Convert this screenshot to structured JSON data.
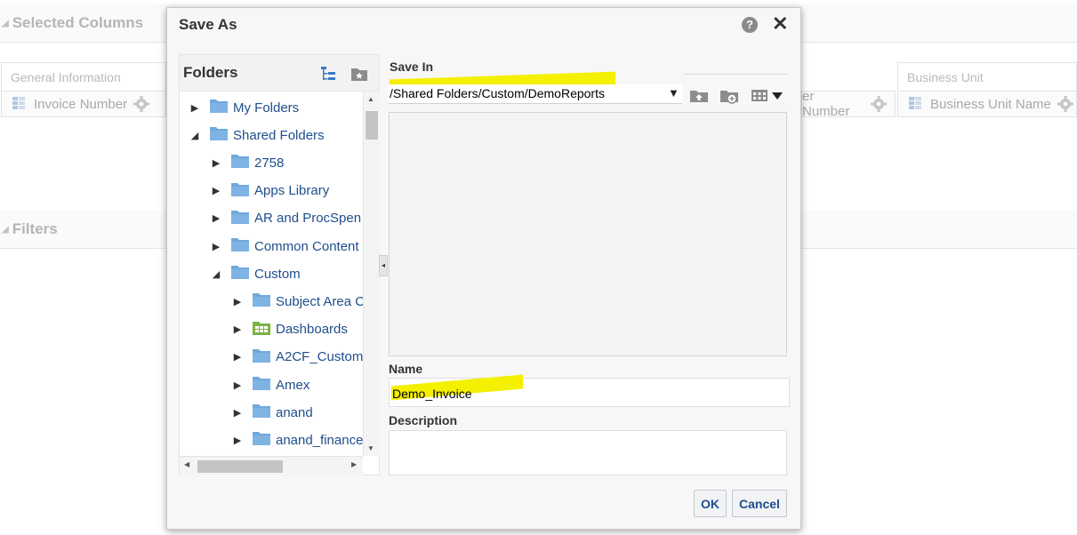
{
  "background": {
    "selected_columns_title": "Selected Columns",
    "filters_title": "Filters",
    "groups": [
      {
        "label": "General Information"
      },
      {
        "label": "Business Unit"
      }
    ],
    "columns": [
      {
        "label": "Invoice Number"
      },
      {
        "label": "er Number"
      },
      {
        "label": "Business Unit Name"
      }
    ]
  },
  "dialog": {
    "title": "Save As",
    "help_glyph": "?",
    "close_glyph": "✕",
    "folders": {
      "title": "Folders",
      "tree": [
        {
          "label": "My Folders",
          "state": "collapsed",
          "level": 0,
          "icon": "folder"
        },
        {
          "label": "Shared Folders",
          "state": "expanded",
          "level": 0,
          "icon": "folder"
        },
        {
          "label": "2758",
          "state": "collapsed",
          "level": 1,
          "icon": "folder"
        },
        {
          "label": "Apps Library",
          "state": "collapsed",
          "level": 1,
          "icon": "folder"
        },
        {
          "label": "AR and ProcSpen",
          "state": "collapsed",
          "level": 1,
          "icon": "folder"
        },
        {
          "label": "Common Content",
          "state": "collapsed",
          "level": 1,
          "icon": "folder"
        },
        {
          "label": "Custom",
          "state": "expanded",
          "level": 1,
          "icon": "folder"
        },
        {
          "label": "Subject Area C",
          "state": "collapsed",
          "level": 2,
          "icon": "folder"
        },
        {
          "label": "Dashboards",
          "state": "collapsed",
          "level": 2,
          "icon": "dashboard"
        },
        {
          "label": "A2CF_Custom",
          "state": "collapsed",
          "level": 2,
          "icon": "folder"
        },
        {
          "label": "Amex",
          "state": "collapsed",
          "level": 2,
          "icon": "folder"
        },
        {
          "label": "anand",
          "state": "collapsed",
          "level": 2,
          "icon": "folder"
        },
        {
          "label": "anand_finance",
          "state": "collapsed",
          "level": 2,
          "icon": "folder"
        }
      ]
    },
    "save_in": {
      "label": "Save In",
      "value": "/Shared Folders/Custom/DemoReports"
    },
    "name": {
      "label": "Name",
      "value": "Demo_Invoice"
    },
    "description": {
      "label": "Description",
      "value": ""
    },
    "buttons": {
      "ok": "OK",
      "cancel": "Cancel"
    },
    "colors": {
      "link": "#1f4e8c",
      "folder": "#6fa8dc",
      "highlight": "#f5ef00"
    }
  }
}
